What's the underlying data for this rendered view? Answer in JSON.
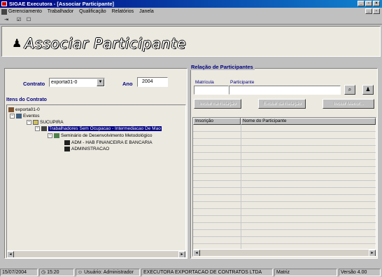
{
  "window": {
    "title": "SIGAE Executora - [Associar Participante]"
  },
  "menu": {
    "items": [
      "Gerenciamento",
      "Trabalhador",
      "Qualificação",
      "Relatórios",
      "Janela"
    ]
  },
  "toolbar": {
    "icons": [
      "exit-icon",
      "checkbox-checked-icon",
      "checkbox-empty-icon"
    ]
  },
  "header": {
    "title": "Associar Participante"
  },
  "contract": {
    "contrato_label": "Contrato",
    "contrato_value": "exporta01-0",
    "ano_label": "Ano",
    "ano_value": "2004",
    "itens_label": "Itens do Contrato"
  },
  "tree": {
    "nodes": [
      {
        "label": "exporta01-0",
        "level": 0,
        "expander": ""
      },
      {
        "label": "Eventos",
        "level": 1,
        "expander": "−"
      },
      {
        "label": "SUCUPIRA",
        "level": 2,
        "expander": "−"
      },
      {
        "label": "Trabalhadores Sem Ocupacao - Intermediacao De Mao",
        "level": 3,
        "expander": "−",
        "selected": true
      },
      {
        "label": "Seminário de Desenvolvimento Metodológico",
        "level": 4,
        "expander": "−"
      },
      {
        "label": "ADM - HAB FINANCEIRA E BANCARIA",
        "level": 5,
        "expander": ""
      },
      {
        "label": "ADMINISTRACAO",
        "level": 5,
        "expander": ""
      }
    ]
  },
  "relacao": {
    "title": "Relação de Participantes",
    "matricula_label": "Matrícula",
    "participante_label": "Participante",
    "matricula_value": "",
    "participante_value": "",
    "buttons": [
      "Incluir na Relação",
      "Excluir da Relação",
      "Incluir Menor..."
    ],
    "columns": [
      "Inscrição",
      "Nome do Participante"
    ]
  },
  "status": {
    "date": "15/07/2004",
    "time": "15:20",
    "user": "Usuário: Administrador",
    "company": "EXECUTORA EXPORTACAO DE CONTRATOS LTDA",
    "unit": "Matriz",
    "version": "Versão 4.00"
  },
  "colors": {
    "title_gradient_start": "#000080",
    "label_blue": "#000080",
    "selection": "#000080",
    "window_bg": "#c0c0c0"
  }
}
